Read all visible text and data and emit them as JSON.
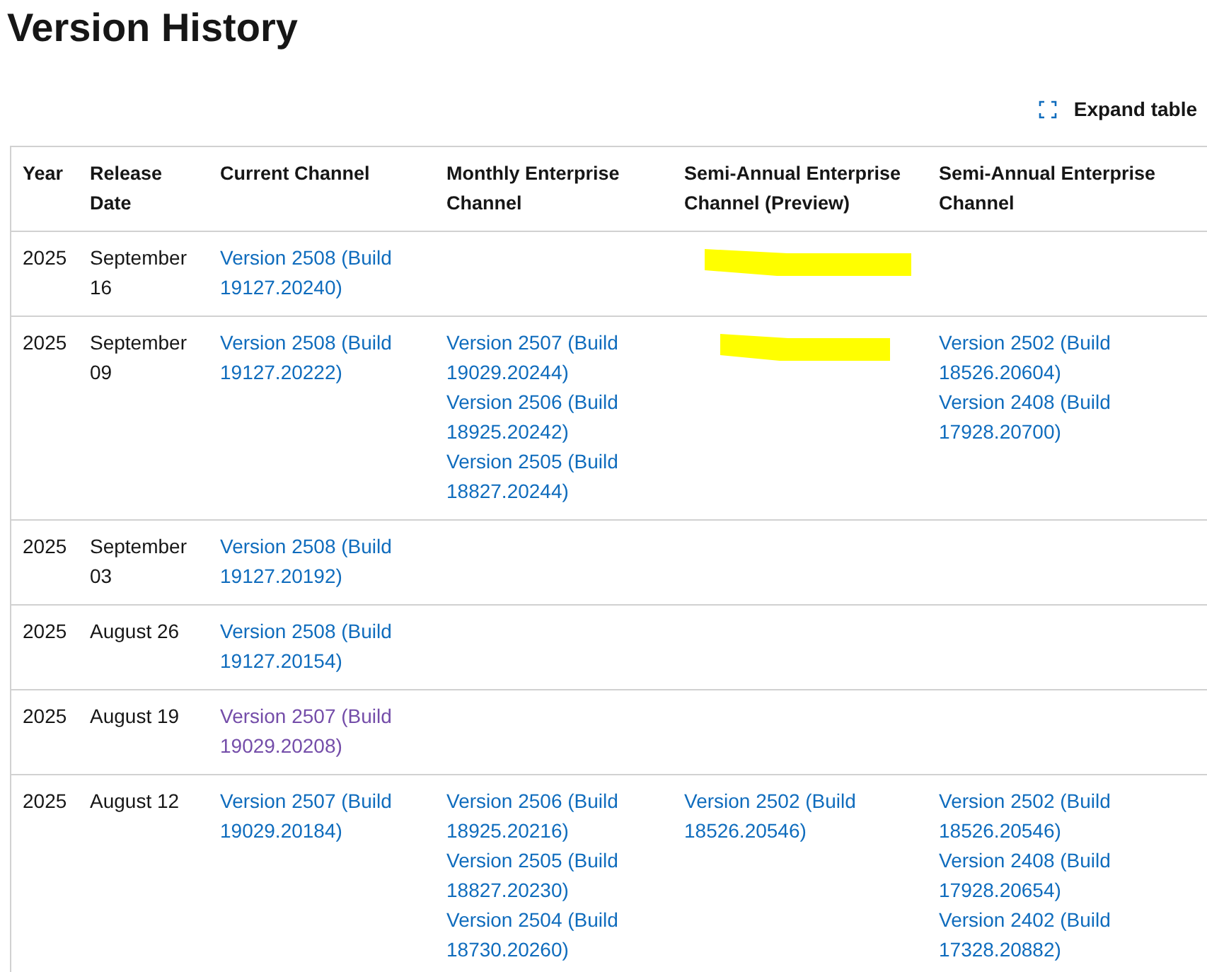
{
  "title": "Version History",
  "expand_button": {
    "label": "Expand table"
  },
  "table": {
    "columns": [
      "Year",
      "Release Date",
      "Current Channel",
      "Monthly Enterprise Channel",
      "Semi-Annual Enterprise Channel (Preview)",
      "Semi-Annual Enterprise Channel"
    ],
    "rows": [
      {
        "cells": [
          {
            "kind": "text",
            "text": "2025"
          },
          {
            "kind": "text",
            "text": "September 16"
          },
          {
            "kind": "links",
            "links": [
              {
                "text": "Version 2508 (Build 19127.20240)",
                "visited": false
              }
            ]
          },
          {
            "kind": "empty"
          },
          {
            "kind": "redacted"
          },
          {
            "kind": "empty"
          }
        ]
      },
      {
        "cells": [
          {
            "kind": "text",
            "text": "2025"
          },
          {
            "kind": "text",
            "text": "September 09"
          },
          {
            "kind": "links",
            "links": [
              {
                "text": "Version 2508 (Build 19127.20222)",
                "visited": false
              }
            ]
          },
          {
            "kind": "links",
            "links": [
              {
                "text": "Version 2507 (Build 19029.20244)",
                "visited": false
              },
              {
                "text": "Version 2506 (Build 18925.20242)",
                "visited": false
              },
              {
                "text": "Version 2505 (Build 18827.20244)",
                "visited": false
              }
            ]
          },
          {
            "kind": "redacted"
          },
          {
            "kind": "links",
            "links": [
              {
                "text": "Version 2502 (Build 18526.20604)",
                "visited": false
              },
              {
                "text": "Version 2408 (Build 17928.20700)",
                "visited": false
              }
            ]
          }
        ]
      },
      {
        "cells": [
          {
            "kind": "text",
            "text": "2025"
          },
          {
            "kind": "text",
            "text": "September 03"
          },
          {
            "kind": "links",
            "links": [
              {
                "text": "Version 2508 (Build 19127.20192)",
                "visited": false
              }
            ]
          },
          {
            "kind": "empty"
          },
          {
            "kind": "empty"
          },
          {
            "kind": "empty"
          }
        ]
      },
      {
        "cells": [
          {
            "kind": "text",
            "text": "2025"
          },
          {
            "kind": "text",
            "text": "August 26"
          },
          {
            "kind": "links",
            "links": [
              {
                "text": "Version 2508 (Build 19127.20154)",
                "visited": false
              }
            ]
          },
          {
            "kind": "empty"
          },
          {
            "kind": "empty"
          },
          {
            "kind": "empty"
          }
        ]
      },
      {
        "cells": [
          {
            "kind": "text",
            "text": "2025"
          },
          {
            "kind": "text",
            "text": "August 19"
          },
          {
            "kind": "links",
            "links": [
              {
                "text": "Version 2507 (Build 19029.20208)",
                "visited": true
              }
            ]
          },
          {
            "kind": "empty"
          },
          {
            "kind": "empty"
          },
          {
            "kind": "empty"
          }
        ]
      },
      {
        "cells": [
          {
            "kind": "text",
            "text": "2025"
          },
          {
            "kind": "text",
            "text": "August 12"
          },
          {
            "kind": "links",
            "links": [
              {
                "text": "Version 2507 (Build 19029.20184)",
                "visited": false
              }
            ]
          },
          {
            "kind": "links",
            "links": [
              {
                "text": "Version 2506 (Build 18925.20216)",
                "visited": false
              },
              {
                "text": "Version 2505 (Build 18827.20230)",
                "visited": false
              },
              {
                "text": "Version 2504 (Build 18730.20260)",
                "visited": false
              }
            ]
          },
          {
            "kind": "links",
            "links": [
              {
                "text": "Version 2502 (Build 18526.20546)",
                "visited": false
              }
            ]
          },
          {
            "kind": "links",
            "links": [
              {
                "text": "Version 2502 (Build 18526.20546)",
                "visited": false
              },
              {
                "text": "Version 2408 (Build 17928.20654)",
                "visited": false
              },
              {
                "text": "Version 2402 (Build 17328.20882)",
                "visited": false
              }
            ]
          }
        ]
      }
    ]
  }
}
